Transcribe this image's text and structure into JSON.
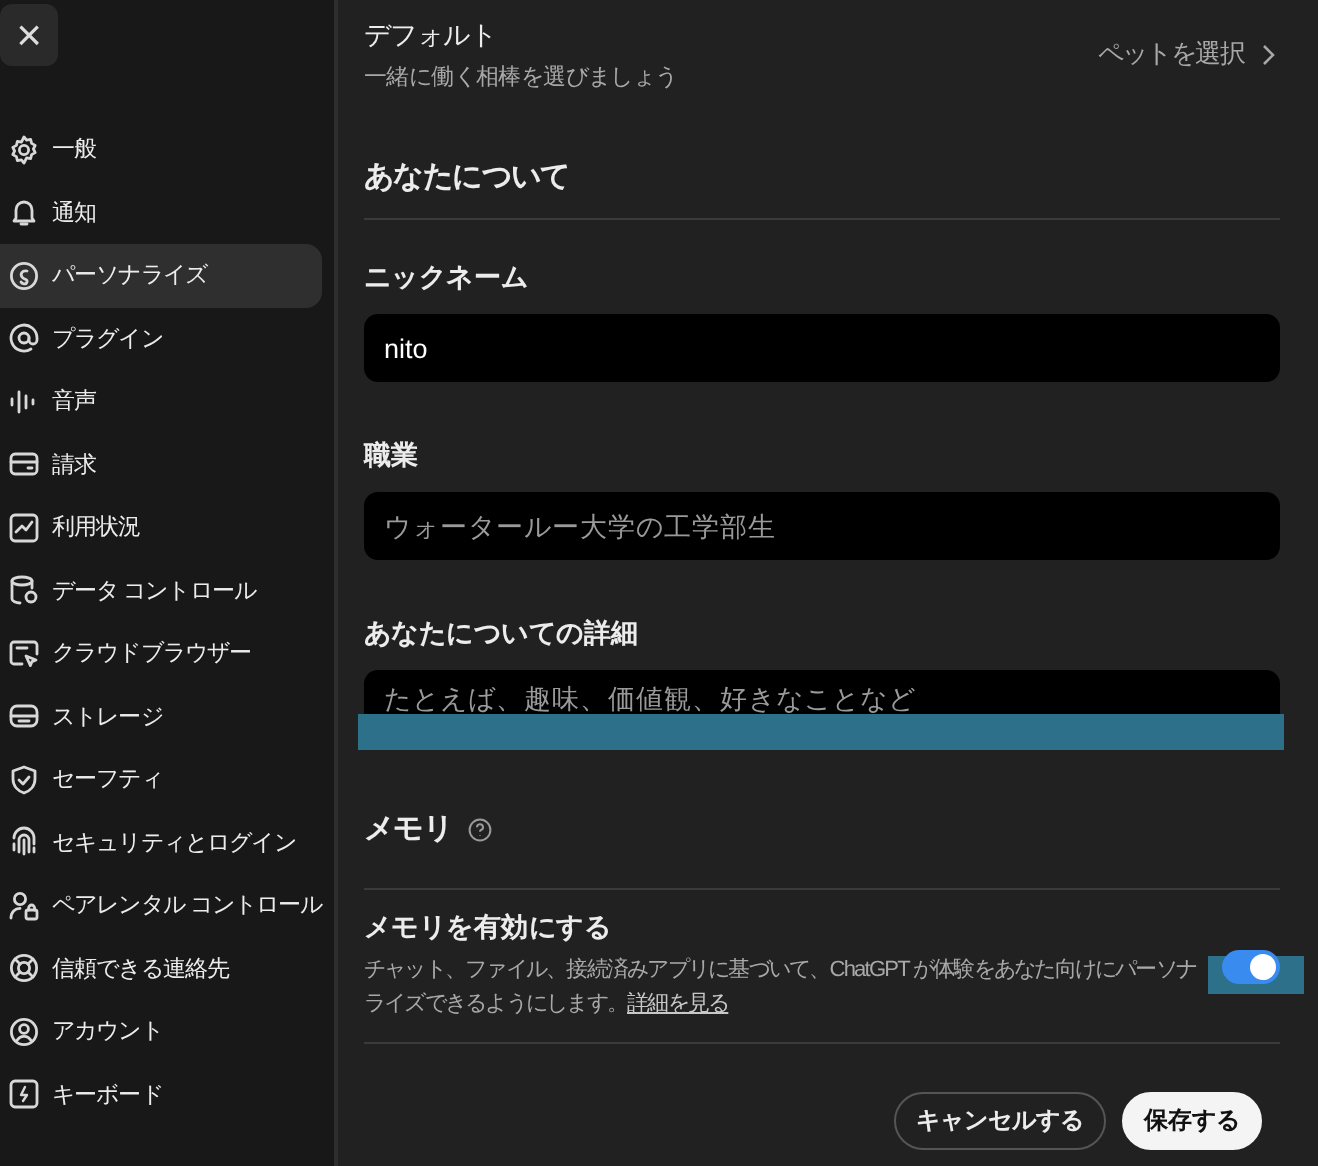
{
  "sidebar": {
    "close": "×",
    "items": [
      {
        "label": "一般",
        "selected": false
      },
      {
        "label": "通知",
        "selected": false
      },
      {
        "label": "パーソナライズ",
        "selected": true
      },
      {
        "label": "プラグイン",
        "selected": false
      },
      {
        "label": "音声",
        "selected": false
      },
      {
        "label": "請求",
        "selected": false
      },
      {
        "label": "利用状況",
        "selected": false
      },
      {
        "label": "データ コントロール",
        "selected": false
      },
      {
        "label": "クラウドブラウザー",
        "selected": false
      },
      {
        "label": "ストレージ",
        "selected": false
      },
      {
        "label": "セーフティ",
        "selected": false
      },
      {
        "label": "セキュリティとログイン",
        "selected": false
      },
      {
        "label": "ペアレンタル コントロール",
        "selected": false
      },
      {
        "label": "信頼できる連絡先",
        "selected": false
      },
      {
        "label": "アカウント",
        "selected": false
      },
      {
        "label": "キーボード",
        "selected": false
      }
    ]
  },
  "pet": {
    "title": "デフォルト",
    "subtitle": "一緒に働く相棒を選びましょう",
    "action": "ペットを選択"
  },
  "about": {
    "heading": "あなたについて",
    "fields": [
      {
        "label": "ニックネーム",
        "value": "nito"
      },
      {
        "label": "職業",
        "placeholder": "ウォータールー大学の工学部生"
      },
      {
        "label": "あなたについての詳細",
        "placeholder": "たとえば、趣味、価値観、好きなことなど"
      }
    ]
  },
  "memory": {
    "heading": "メモリ",
    "toggle": {
      "label": "メモリを有効にする",
      "description": "チャット、ファイル、接続済みアプリに基づいて、ChatGPT が体験をあなた向けにパーソナライズできるようにします。",
      "link": "詳細を見る",
      "on": true
    }
  },
  "buttons": [
    {
      "label": "キャンセルする",
      "kind": "secondary"
    },
    {
      "label": "保存する",
      "kind": "primary"
    }
  ]
}
